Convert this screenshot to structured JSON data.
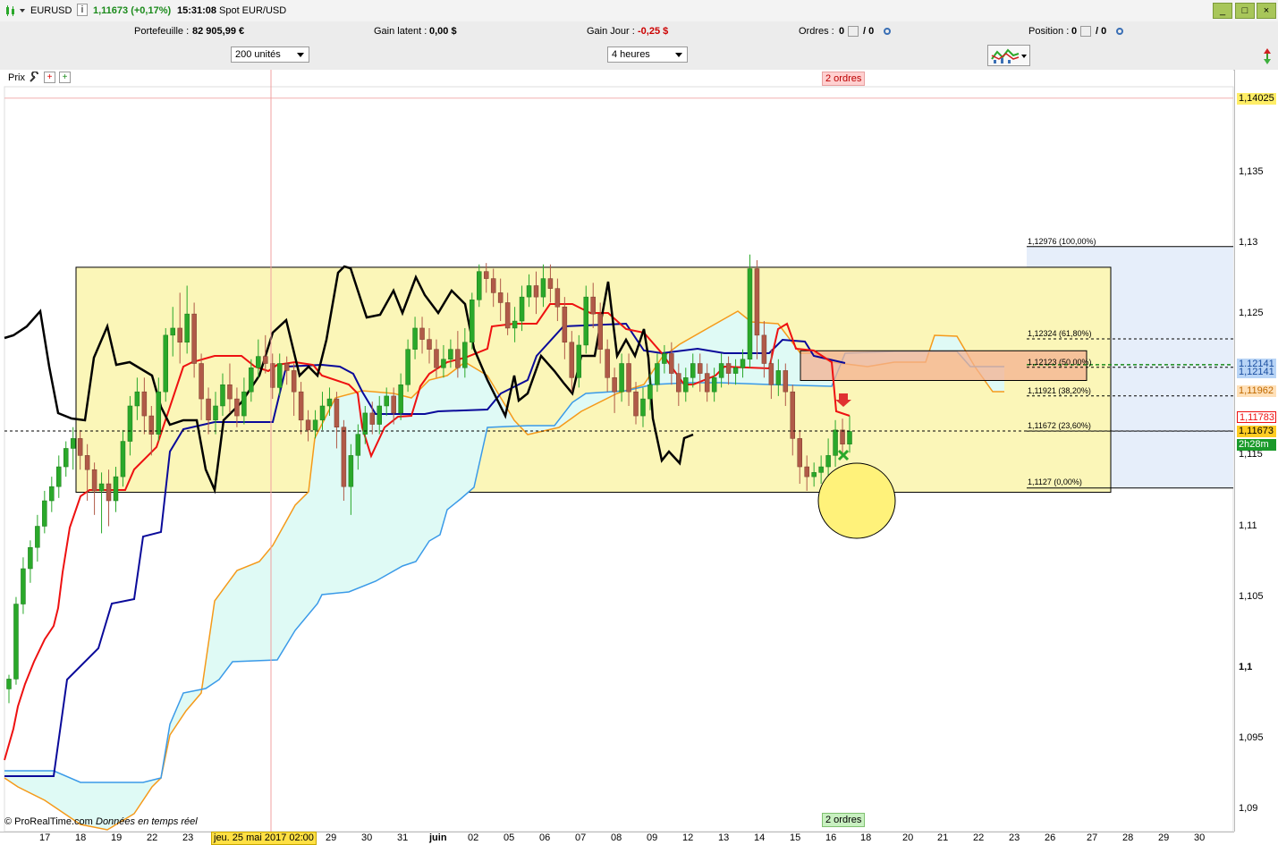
{
  "header": {
    "symbol": "EURUSD",
    "info_icon": "i",
    "price_change": "1,11673 (+0,17%)",
    "time": "15:31:08",
    "instrument": "Spot EUR/USD",
    "window_buttons": [
      "_",
      "□",
      "×"
    ]
  },
  "account": {
    "portefeuille_label": "Portefeuille :",
    "portefeuille_value": "82 905,99 €",
    "gain_latent_label": "Gain latent :",
    "gain_latent_value": "0,00 $",
    "gain_jour_label": "Gain Jour :",
    "gain_jour_value": "-0,25 $",
    "ordres_label": "Ordres :",
    "ordres_value": "0",
    "ordres_sep": "/ 0",
    "position_label": "Position :",
    "position_value": "0",
    "position_sep": "/ 0"
  },
  "toolbar": {
    "quantity": "200 unités",
    "timeframe": "4 heures"
  },
  "chart_header": {
    "prix_label": "Prix",
    "orders_top": "2 ordres",
    "orders_bottom": "2 ordres",
    "watermark": "© ProRealTime.com",
    "watermark_sub": "Données en temps réel",
    "cursor_date": "jeu. 25 mai 2017 02:00"
  },
  "colors": {
    "black_line": "#000000",
    "red_line": "#ee1111",
    "blue_line": "#0a0a9a",
    "orange_line": "#f59a1a",
    "light_blue_line": "#3a9ae8",
    "cloud_fill": "#dffaf5",
    "box_fill": "#fbf6b8",
    "zone_fill": "#f4b090",
    "fib_fill": "#e6eefa",
    "up_candle": "#2aa82a",
    "down_candle": "#b05a48"
  },
  "chart_data": {
    "type": "candlestick",
    "y_axis": {
      "ticks": [
        "1,135",
        "1,13",
        "1,125",
        "1,115",
        "1,11",
        "1,105",
        "1,1",
        "1,095",
        "1,09"
      ],
      "min": 1.089,
      "max": 1.1425
    },
    "x_axis": {
      "ticks": [
        "17",
        "18",
        "19",
        "22",
        "23",
        "29",
        "30",
        "31",
        "juin",
        "02",
        "05",
        "06",
        "07",
        "08",
        "09",
        "12",
        "13",
        "14",
        "15",
        "16",
        "18",
        "20",
        "21",
        "22",
        "23",
        "26",
        "27",
        "28",
        "29",
        "30"
      ]
    },
    "price_tags": [
      {
        "text": "1,14025",
        "value": 1.14025,
        "bg": "#ffee66",
        "fg": "#000000"
      },
      {
        "text": "1,12141",
        "value": 1.12141,
        "bg": "#b8d4f6",
        "fg": "#1a4ea0"
      },
      {
        "text": "1,12141",
        "value": 1.12141,
        "bg": "#b8d4f6",
        "fg": "#1a4ea0"
      },
      {
        "text": "1,11962",
        "value": 1.11962,
        "bg": "#ffe0b8",
        "fg": "#c06a00"
      },
      {
        "text": "1,11783",
        "value": 1.11783,
        "bg": "#ffffff",
        "fg": "#ee1111"
      },
      {
        "text": "1,11673",
        "value": 1.11673,
        "bg": "#ffcc22",
        "fg": "#000000"
      },
      {
        "text": "2h28m",
        "value": 1.1152,
        "bg": "#1a9a2a",
        "fg": "#ffffff"
      }
    ],
    "fibonacci": [
      {
        "label": "1,12976 (100,00%)",
        "value": 1.12976
      },
      {
        "label": "1,12324 (61,80%)",
        "value": 1.12324
      },
      {
        "label": "1,12123 (50,00%)",
        "value": 1.12123
      },
      {
        "label": "1,11921 (38,20%)",
        "value": 1.11921
      },
      {
        "label": "1,11672 (23,60%)",
        "value": 1.11672
      },
      {
        "label": "1,1127 (0,00%)",
        "value": 1.1127
      }
    ],
    "rectangle": {
      "top": 1.1283,
      "bottom": 1.1124
    },
    "zone": {
      "top": 1.1224,
      "bottom": 1.1203
    },
    "current_price": 1.11673,
    "candles": [
      [
        1.0985,
        1.0992,
        1.0975,
        1.0995
      ],
      [
        1.0992,
        1.1045,
        1.0988,
        1.105
      ],
      [
        1.1045,
        1.107,
        1.1038,
        1.1078
      ],
      [
        1.107,
        1.1085,
        1.106,
        1.109
      ],
      [
        1.1085,
        1.11,
        1.1075,
        1.1108
      ],
      [
        1.11,
        1.1118,
        1.1095,
        1.1125
      ],
      [
        1.1118,
        1.1128,
        1.111,
        1.1135
      ],
      [
        1.1128,
        1.1142,
        1.112,
        1.115
      ],
      [
        1.1142,
        1.1155,
        1.1135,
        1.116
      ],
      [
        1.1155,
        1.1162,
        1.114,
        1.117
      ],
      [
        1.1162,
        1.115,
        1.114,
        1.1168
      ],
      [
        1.115,
        1.114,
        1.1118,
        1.1158
      ],
      [
        1.114,
        1.1125,
        1.1108,
        1.1145
      ],
      [
        1.1125,
        1.113,
        1.1095,
        1.1138
      ],
      [
        1.113,
        1.1118,
        1.11,
        1.114
      ],
      [
        1.1118,
        1.1135,
        1.111,
        1.1142
      ],
      [
        1.1135,
        1.116,
        1.1128,
        1.1168
      ],
      [
        1.116,
        1.1185,
        1.115,
        1.1192
      ],
      [
        1.1185,
        1.1195,
        1.1175,
        1.1205
      ],
      [
        1.1195,
        1.1178,
        1.1165,
        1.1205
      ],
      [
        1.1178,
        1.1165,
        1.115,
        1.1185
      ],
      [
        1.1165,
        1.1195,
        1.116,
        1.1205
      ],
      [
        1.1195,
        1.1235,
        1.1188,
        1.124
      ],
      [
        1.1235,
        1.124,
        1.122,
        1.1255
      ],
      [
        1.124,
        1.123,
        1.1215,
        1.1265
      ],
      [
        1.123,
        1.125,
        1.1222,
        1.127
      ],
      [
        1.125,
        1.1215,
        1.1205,
        1.1258
      ],
      [
        1.1215,
        1.119,
        1.1175,
        1.1222
      ],
      [
        1.119,
        1.1175,
        1.1165,
        1.1198
      ],
      [
        1.1175,
        1.1185,
        1.1165,
        1.1195
      ],
      [
        1.1185,
        1.12,
        1.1178,
        1.1208
      ],
      [
        1.12,
        1.119,
        1.118,
        1.1215
      ],
      [
        1.119,
        1.1178,
        1.117,
        1.1198
      ],
      [
        1.1178,
        1.1195,
        1.1172,
        1.1205
      ],
      [
        1.1195,
        1.1212,
        1.1188,
        1.1218
      ],
      [
        1.1212,
        1.122,
        1.1205,
        1.1232
      ],
      [
        1.122,
        1.1215,
        1.1208,
        1.1235
      ],
      [
        1.1215,
        1.1198,
        1.119,
        1.1222
      ],
      [
        1.1198,
        1.1215,
        1.1192,
        1.1222
      ],
      [
        1.1215,
        1.121,
        1.12,
        1.122
      ],
      [
        1.121,
        1.1195,
        1.1178,
        1.1215
      ],
      [
        1.1195,
        1.1175,
        1.1165,
        1.1202
      ],
      [
        1.1175,
        1.1168,
        1.116,
        1.1182
      ],
      [
        1.1168,
        1.1175,
        1.1162,
        1.1182
      ],
      [
        1.1175,
        1.1185,
        1.1168,
        1.1195
      ],
      [
        1.1185,
        1.119,
        1.1178,
        1.1198
      ],
      [
        1.119,
        1.117,
        1.1155,
        1.1195
      ],
      [
        1.117,
        1.1128,
        1.1118,
        1.1175
      ],
      [
        1.1128,
        1.115,
        1.1108,
        1.1158
      ],
      [
        1.115,
        1.1165,
        1.114,
        1.1172
      ],
      [
        1.1165,
        1.118,
        1.1158,
        1.1185
      ],
      [
        1.118,
        1.1172,
        1.1165,
        1.1188
      ],
      [
        1.1172,
        1.1185,
        1.1165,
        1.1192
      ],
      [
        1.1185,
        1.1192,
        1.1178,
        1.1198
      ],
      [
        1.1192,
        1.118,
        1.1172,
        1.1198
      ],
      [
        1.118,
        1.12,
        1.1175,
        1.1208
      ],
      [
        1.12,
        1.1225,
        1.1195,
        1.1232
      ],
      [
        1.1225,
        1.124,
        1.1218,
        1.1248
      ],
      [
        1.124,
        1.1232,
        1.1222,
        1.1248
      ],
      [
        1.1232,
        1.1225,
        1.1215,
        1.124
      ],
      [
        1.1225,
        1.1212,
        1.1205,
        1.1232
      ],
      [
        1.1212,
        1.1218,
        1.1205,
        1.1228
      ],
      [
        1.1218,
        1.1225,
        1.1212,
        1.1232
      ],
      [
        1.1225,
        1.1212,
        1.1205,
        1.1238
      ],
      [
        1.1212,
        1.123,
        1.1205,
        1.124
      ],
      [
        1.123,
        1.126,
        1.1225,
        1.1265
      ],
      [
        1.126,
        1.128,
        1.1255,
        1.1285
      ],
      [
        1.128,
        1.1275,
        1.1265,
        1.1286
      ],
      [
        1.1275,
        1.1265,
        1.1255,
        1.1282
      ],
      [
        1.1265,
        1.1258,
        1.1245,
        1.1275
      ],
      [
        1.1258,
        1.124,
        1.1235,
        1.1265
      ],
      [
        1.124,
        1.1245,
        1.123,
        1.1255
      ],
      [
        1.1245,
        1.1262,
        1.1238,
        1.127
      ],
      [
        1.1262,
        1.127,
        1.1255,
        1.1278
      ],
      [
        1.127,
        1.1262,
        1.125,
        1.128
      ],
      [
        1.1262,
        1.1275,
        1.1255,
        1.1285
      ],
      [
        1.1275,
        1.1268,
        1.1258,
        1.1285
      ],
      [
        1.1268,
        1.1255,
        1.1245,
        1.1275
      ],
      [
        1.1255,
        1.123,
        1.1218,
        1.1262
      ],
      [
        1.123,
        1.1205,
        1.1195,
        1.1238
      ],
      [
        1.1205,
        1.1228,
        1.1198,
        1.1235
      ],
      [
        1.1228,
        1.1262,
        1.1222,
        1.127
      ],
      [
        1.1262,
        1.125,
        1.124,
        1.1272
      ],
      [
        1.125,
        1.1225,
        1.1215,
        1.1258
      ],
      [
        1.1225,
        1.1205,
        1.1195,
        1.1232
      ],
      [
        1.1205,
        1.1195,
        1.118,
        1.1212
      ],
      [
        1.1195,
        1.1215,
        1.1188,
        1.1222
      ],
      [
        1.1215,
        1.1195,
        1.1185,
        1.1222
      ],
      [
        1.1195,
        1.1178,
        1.1172,
        1.1202
      ],
      [
        1.1178,
        1.119,
        1.117,
        1.1198
      ],
      [
        1.119,
        1.12,
        1.1182,
        1.1208
      ],
      [
        1.12,
        1.1215,
        1.1195,
        1.1222
      ],
      [
        1.1215,
        1.1222,
        1.1208,
        1.1228
      ],
      [
        1.1222,
        1.1208,
        1.12,
        1.123
      ],
      [
        1.1208,
        1.1195,
        1.1185,
        1.1215
      ],
      [
        1.1195,
        1.1205,
        1.1188,
        1.1212
      ],
      [
        1.1205,
        1.1215,
        1.1198,
        1.1222
      ],
      [
        1.1215,
        1.1208,
        1.1195,
        1.1222
      ],
      [
        1.1208,
        1.1195,
        1.1188,
        1.1215
      ],
      [
        1.1195,
        1.1205,
        1.1188,
        1.1212
      ],
      [
        1.1205,
        1.1215,
        1.1198,
        1.1222
      ],
      [
        1.1215,
        1.1208,
        1.12,
        1.122
      ],
      [
        1.1208,
        1.1212,
        1.12,
        1.1218
      ],
      [
        1.1212,
        1.1218,
        1.1205,
        1.1225
      ],
      [
        1.1218,
        1.1282,
        1.1212,
        1.1292
      ],
      [
        1.1282,
        1.1235,
        1.1218,
        1.1288
      ],
      [
        1.1235,
        1.1215,
        1.1205,
        1.1245
      ],
      [
        1.1215,
        1.12,
        1.119,
        1.1225
      ],
      [
        1.12,
        1.121,
        1.1192,
        1.1218
      ],
      [
        1.121,
        1.1195,
        1.1185,
        1.1215
      ],
      [
        1.1195,
        1.1162,
        1.115,
        1.12
      ],
      [
        1.1162,
        1.1142,
        1.113,
        1.1168
      ],
      [
        1.1142,
        1.1135,
        1.1125,
        1.115
      ],
      [
        1.1135,
        1.1138,
        1.1128,
        1.1145
      ],
      [
        1.1138,
        1.1142,
        1.113,
        1.115
      ],
      [
        1.1142,
        1.115,
        1.1135,
        1.1162
      ],
      [
        1.115,
        1.1168,
        1.1142,
        1.1175
      ],
      [
        1.1168,
        1.1158,
        1.115,
        1.1176
      ],
      [
        1.1158,
        1.1167,
        1.1152,
        1.1178
      ]
    ]
  }
}
